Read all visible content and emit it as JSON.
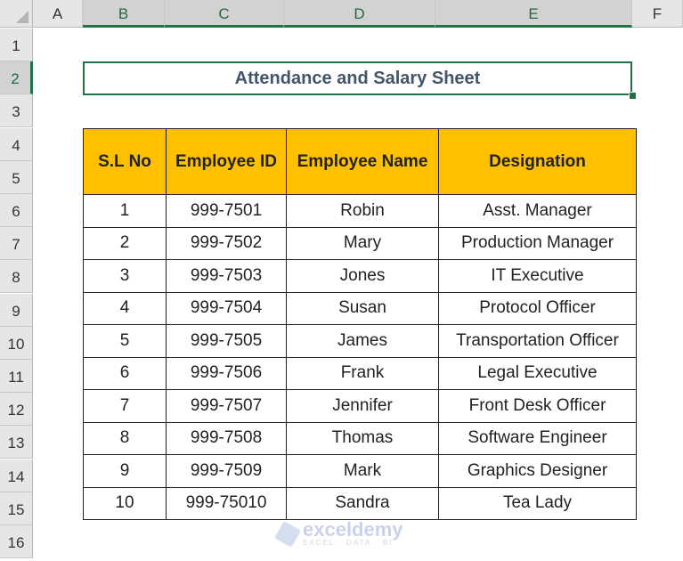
{
  "sheet": {
    "columns": [
      "A",
      "B",
      "C",
      "D",
      "E",
      "F"
    ],
    "rows": [
      "1",
      "2",
      "3",
      "4",
      "5",
      "6",
      "7",
      "8",
      "9",
      "10",
      "11",
      "12",
      "13",
      "14",
      "15",
      "16"
    ],
    "selected_cell": "B2"
  },
  "title": "Attendance and Salary Sheet",
  "table": {
    "headers": [
      "S.L No",
      "Employee ID",
      "Employee Name",
      "Designation"
    ],
    "rows": [
      [
        "1",
        "999-7501",
        "Robin",
        "Asst. Manager"
      ],
      [
        "2",
        "999-7502",
        "Mary",
        "Production Manager"
      ],
      [
        "3",
        "999-7503",
        "Jones",
        "IT Executive"
      ],
      [
        "4",
        "999-7504",
        "Susan",
        "Protocol Officer"
      ],
      [
        "5",
        "999-7505",
        "James",
        "Transportation Officer"
      ],
      [
        "6",
        "999-7506",
        "Frank",
        "Legal Executive"
      ],
      [
        "7",
        "999-7507",
        "Jennifer",
        "Front Desk Officer"
      ],
      [
        "8",
        "999-7508",
        "Thomas",
        "Software Engineer"
      ],
      [
        "9",
        "999-7509",
        "Mark",
        "Graphics Designer"
      ],
      [
        "10",
        "999-75010",
        "Sandra",
        "Tea Lady"
      ]
    ]
  },
  "watermark": {
    "name": "exceldemy",
    "tagline": "EXCEL · DATA · BI"
  },
  "colors": {
    "header_fill": "#ffc000",
    "selection": "#217346",
    "title_text": "#44546a"
  }
}
